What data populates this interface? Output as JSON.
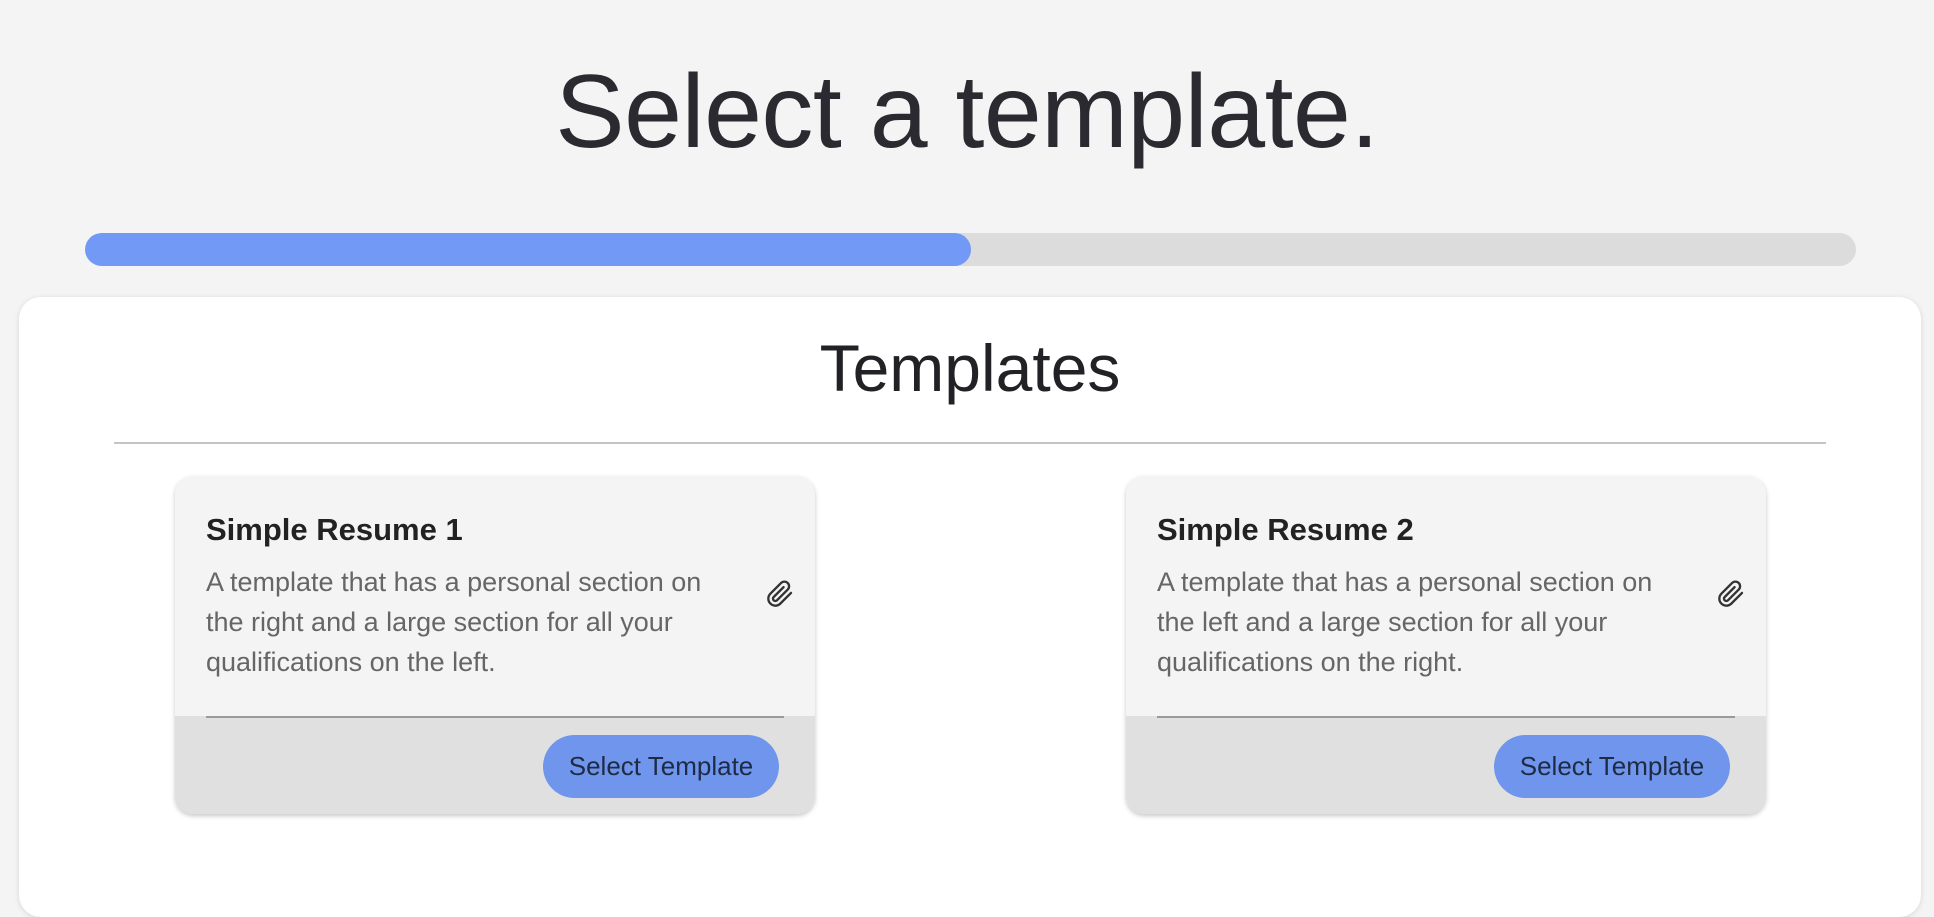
{
  "page": {
    "title": "Select a template."
  },
  "progress": {
    "percent": 50,
    "fill_color": "#7399f6",
    "track_color": "#dcdcdc"
  },
  "templates_panel": {
    "title": "Templates",
    "cards": [
      {
        "title": "Simple Resume 1",
        "description": "A template that has a personal section on the right and a large section for all your qualifications on the left.",
        "icon": "paperclip-icon",
        "button_label": "Select Template"
      },
      {
        "title": "Simple Resume 2",
        "description": "A template that has a personal section on the left and a large section for all your qualifications on the right.",
        "icon": "paperclip-icon",
        "button_label": "Select Template"
      }
    ]
  },
  "colors": {
    "accent": "#6f95ec",
    "background": "#f4f4f4"
  }
}
